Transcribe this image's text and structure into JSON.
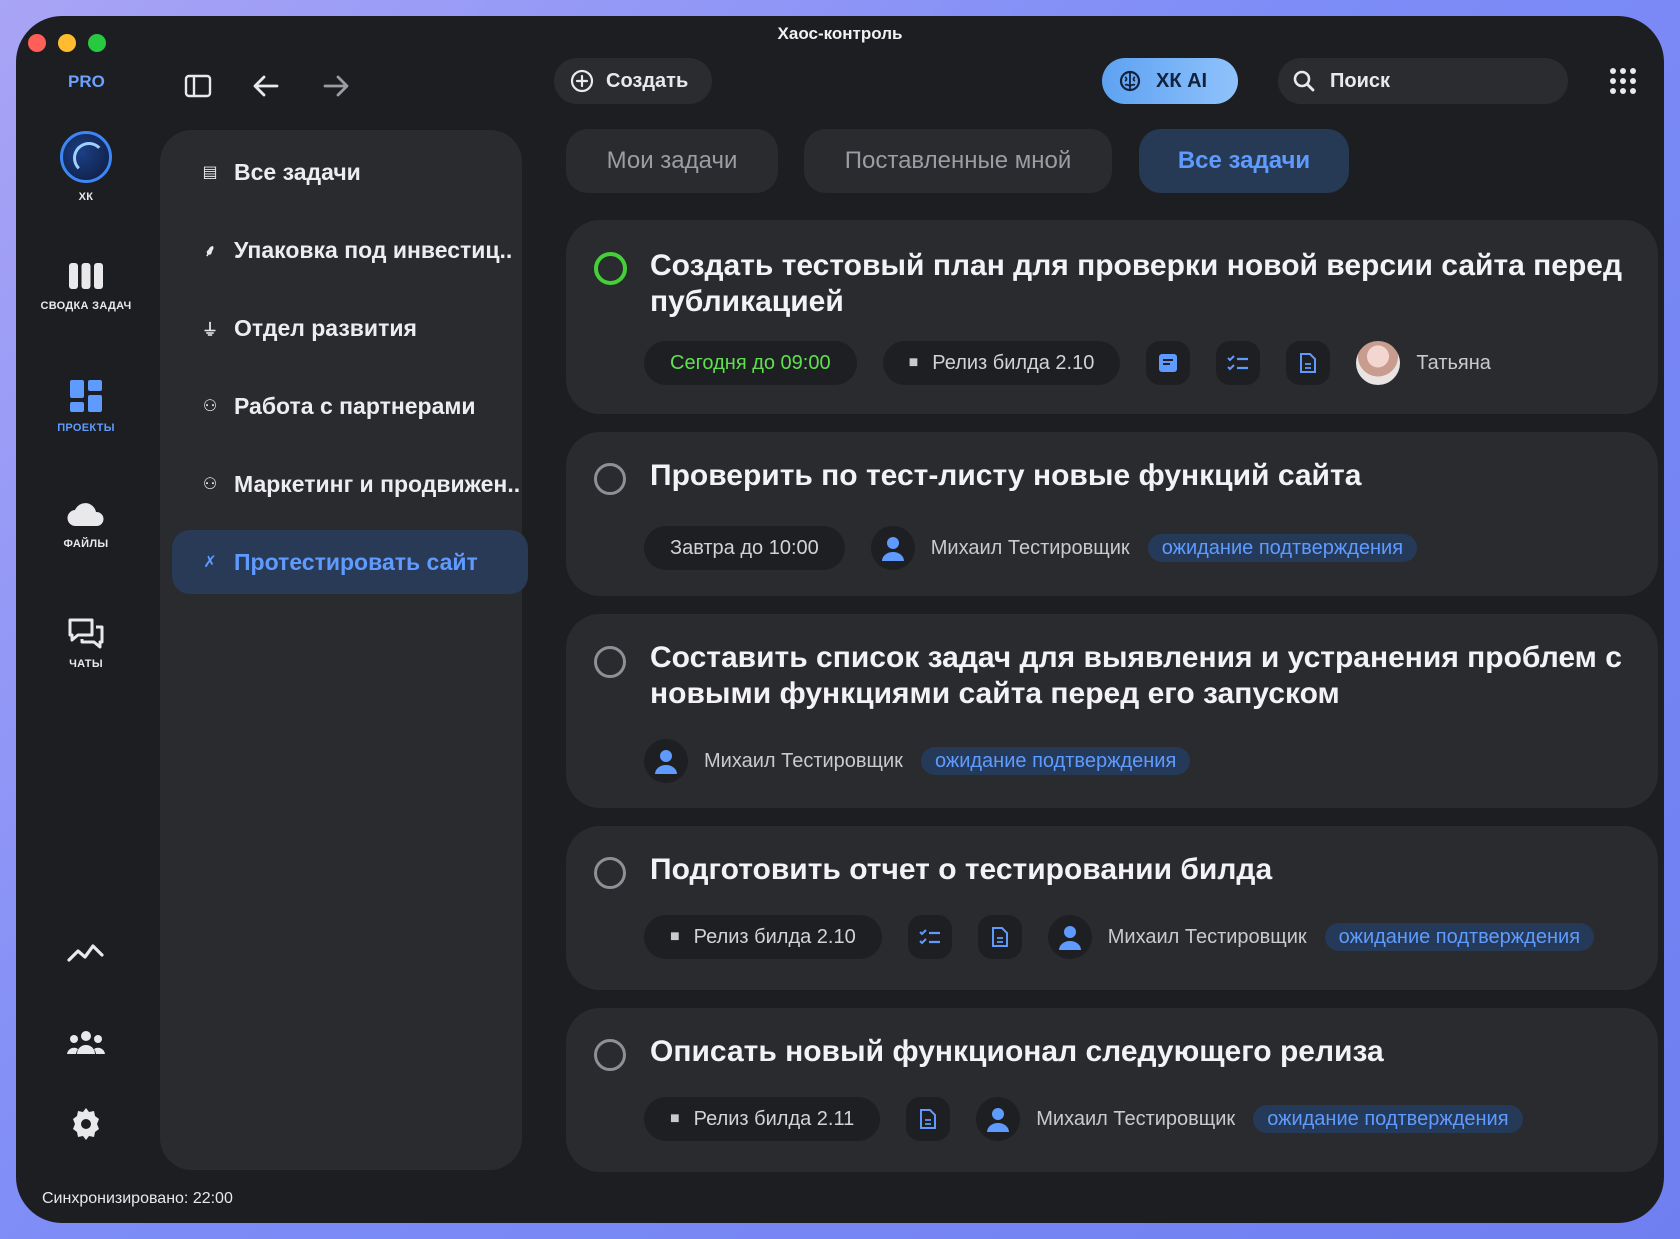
{
  "window": {
    "title": "Хаос-контроль"
  },
  "toolbar": {
    "pro_badge": "PRO",
    "create_label": "Создать",
    "ai_label": "ХК AI",
    "search_placeholder": "Поиск"
  },
  "rail": {
    "items": [
      {
        "label": "ХК",
        "icon": "logo-icon"
      },
      {
        "label": "СВОДКА ЗАДАЧ",
        "icon": "columns-icon"
      },
      {
        "label": "ПРОЕКТЫ",
        "icon": "dashboard-icon",
        "active": true
      },
      {
        "label": "ФАЙЛЫ",
        "icon": "cloud-icon"
      },
      {
        "label": "ЧАТЫ",
        "icon": "chat-icon"
      }
    ],
    "bottom_icons": [
      "analytics-icon",
      "team-icon",
      "gear-icon"
    ]
  },
  "sidebar": {
    "items": [
      {
        "label": "Все задачи",
        "icon": "list-icon"
      },
      {
        "label": "Упаковка под инвестиц..",
        "icon": "chart-icon"
      },
      {
        "label": "Отдел развития",
        "icon": "lamp-icon"
      },
      {
        "label": "Работа с партнерами",
        "icon": "people-icon"
      },
      {
        "label": "Маркетинг и продвижен..",
        "icon": "people-icon"
      },
      {
        "label": "Протестировать сайт",
        "icon": "tools-icon",
        "active": true
      }
    ]
  },
  "tabs": [
    {
      "label": "Мои задачи"
    },
    {
      "label": "Поставленные мной"
    },
    {
      "label": "Все задачи",
      "active": true
    }
  ],
  "tasks": [
    {
      "title": "Создать тестовый план для проверки новой версии сайта перед публикацией",
      "deadline": "Сегодня до 09:00",
      "project": "Релиз билда 2.10",
      "assignee": "Татьяна"
    },
    {
      "title": "Проверить по тест-листу новые функций сайта",
      "deadline": "Завтра до 10:00",
      "assignee": "Михаил Тестировщик",
      "status": "ожидание подтверждения"
    },
    {
      "title": "Составить список задач для выявления и устранения проблем с новыми функциями сайта перед его запуском",
      "assignee": "Михаил Тестировщик",
      "status": "ожидание подтверждения"
    },
    {
      "title": "Подготовить отчет о тестировании билда",
      "project": "Релиз билда 2.10",
      "assignee": "Михаил Тестировщик",
      "status": "ожидание подтверждения"
    },
    {
      "title": "Описать новый функционал следующего релиза",
      "project": "Релиз билда 2.11",
      "assignee": "Михаил Тестировщик",
      "status": "ожидание подтверждения"
    }
  ],
  "footer": {
    "sync_text": "Синхронизировано: 22:00"
  },
  "colors": {
    "accent": "#5f9bff",
    "success": "#44d138",
    "background": "#1d1e21",
    "card": "#2a2b2f"
  }
}
